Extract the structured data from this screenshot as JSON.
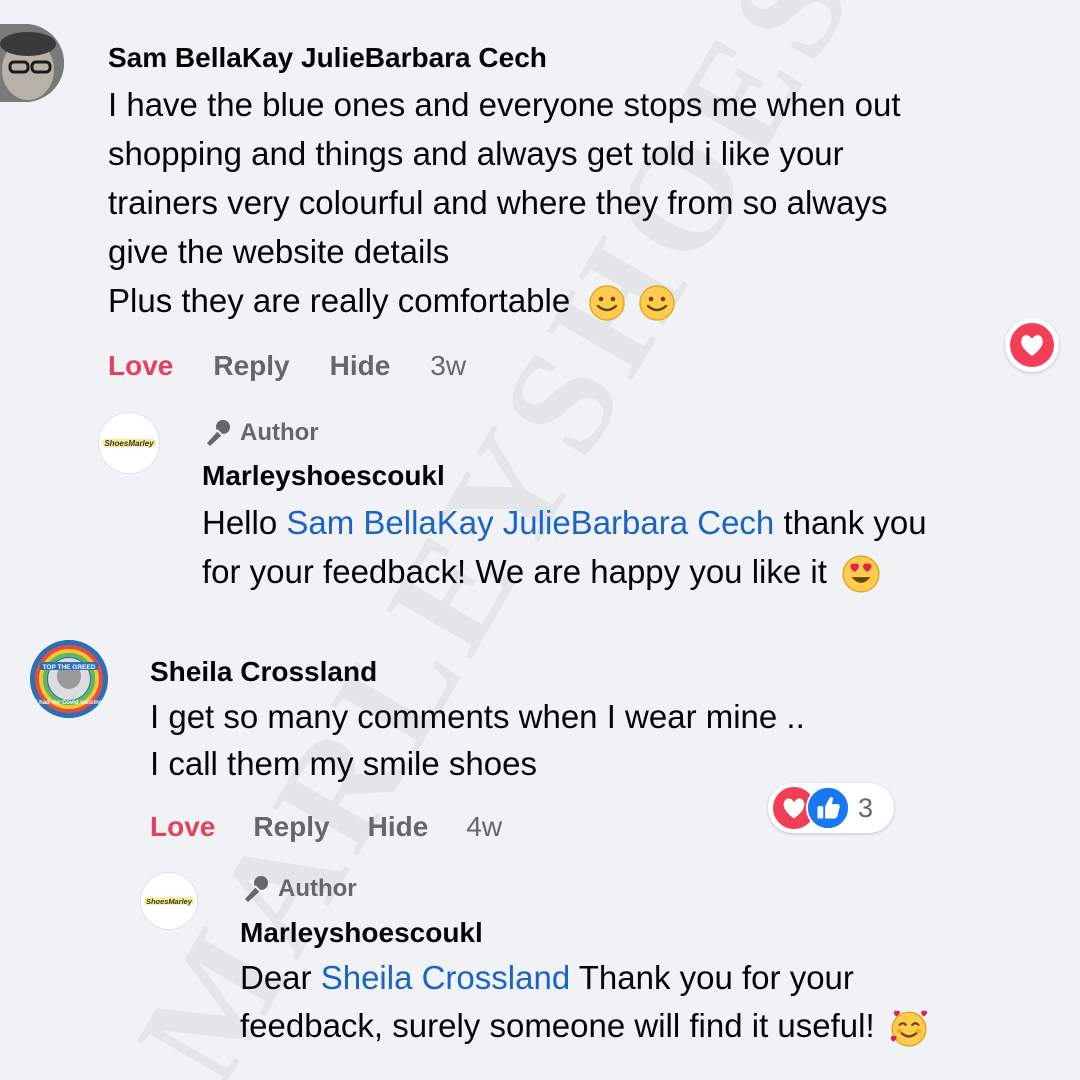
{
  "comments": [
    {
      "author": "Sam BellaKay JulieBarbara Cech",
      "lines": [
        "I have the blue ones and everyone stops me when out",
        "shopping and things and always get told i like your",
        "trainers very colourful and where they from so always",
        "give the website details",
        "Plus they are really comfortable"
      ],
      "actions": {
        "love": "Love",
        "reply": "Reply",
        "hide": "Hide",
        "time": "3w"
      },
      "reply": {
        "badge": "Author",
        "author": "Marleyshoescoukl",
        "greeting": "Hello",
        "mention": "Sam BellaKay JulieBarbara Cech",
        "text_rest_line1": "thank you",
        "text_line2": "for your feedback! We are happy you like it"
      }
    },
    {
      "author": "Sheila Crossland",
      "lines": [
        "I get so many comments when I wear mine ..",
        "I call them my smile shoes"
      ],
      "actions": {
        "love": "Love",
        "reply": "Reply",
        "hide": "Hide",
        "time": "4w"
      },
      "reaction_count": "3",
      "reply": {
        "badge": "Author",
        "author": "Marleyshoescoukl",
        "greeting": "Dear",
        "mention": "Sheila Crossland",
        "text_rest_line1": "Thank you for your",
        "text_line2": "feedback, surely someone will find it useful!"
      }
    }
  ],
  "avatar_badge_text": {
    "sheila_top": "TOP THE GREED",
    "sheila_bottom": "I had my Covid vaccine"
  },
  "logo_text": "ShoesMarley",
  "watermark_text": "MARLEYSHOES",
  "colors": {
    "background": "#f0f2f5",
    "love": "#e4405f",
    "mention": "#1a64c8",
    "like_blue": "#1877f2",
    "muted": "#65676b"
  },
  "icons": [
    "microphone-icon",
    "heart-reaction-icon",
    "like-reaction-icon",
    "smile-emoji",
    "heart-eyes-emoji",
    "smiling-hearts-emoji"
  ]
}
